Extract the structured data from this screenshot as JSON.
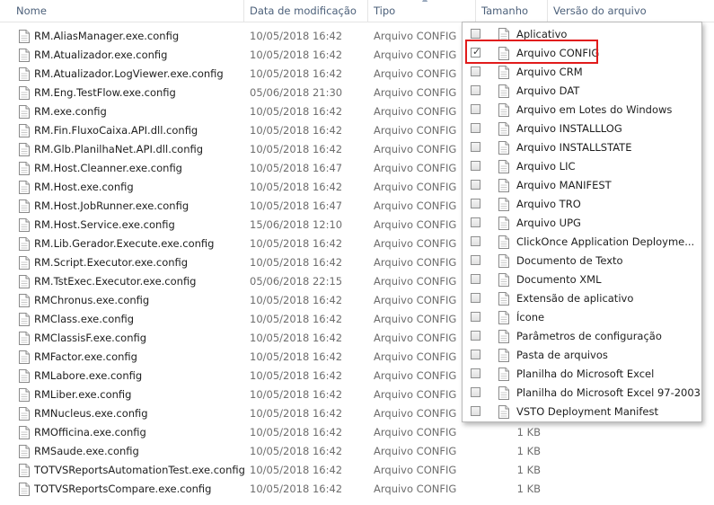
{
  "header": {
    "name": "Nome",
    "date": "Data de modificação",
    "type": "Tipo",
    "size": "Tamanho",
    "version": "Versão do arquivo"
  },
  "files": [
    {
      "name": "RM.AliasManager.exe.config",
      "date": "10/05/2018 16:42",
      "type": "Arquivo CONFIG",
      "size": ""
    },
    {
      "name": "RM.Atualizador.exe.config",
      "date": "10/05/2018 16:42",
      "type": "Arquivo CONFIG",
      "size": ""
    },
    {
      "name": "RM.Atualizador.LogViewer.exe.config",
      "date": "10/05/2018 16:42",
      "type": "Arquivo CONFIG",
      "size": ""
    },
    {
      "name": "RM.Eng.TestFlow.exe.config",
      "date": "05/06/2018 21:30",
      "type": "Arquivo CONFIG",
      "size": ""
    },
    {
      "name": "RM.exe.config",
      "date": "10/05/2018 16:42",
      "type": "Arquivo CONFIG",
      "size": ""
    },
    {
      "name": "RM.Fin.FluxoCaixa.API.dll.config",
      "date": "10/05/2018 16:42",
      "type": "Arquivo CONFIG",
      "size": ""
    },
    {
      "name": "RM.Glb.PlanilhaNet.API.dll.config",
      "date": "10/05/2018 16:42",
      "type": "Arquivo CONFIG",
      "size": ""
    },
    {
      "name": "RM.Host.Cleanner.exe.config",
      "date": "10/05/2018 16:47",
      "type": "Arquivo CONFIG",
      "size": ""
    },
    {
      "name": "RM.Host.exe.config",
      "date": "10/05/2018 16:42",
      "type": "Arquivo CONFIG",
      "size": ""
    },
    {
      "name": "RM.Host.JobRunner.exe.config",
      "date": "10/05/2018 16:47",
      "type": "Arquivo CONFIG",
      "size": ""
    },
    {
      "name": "RM.Host.Service.exe.config",
      "date": "15/06/2018 12:10",
      "type": "Arquivo CONFIG",
      "size": ""
    },
    {
      "name": "RM.Lib.Gerador.Execute.exe.config",
      "date": "10/05/2018 16:42",
      "type": "Arquivo CONFIG",
      "size": ""
    },
    {
      "name": "RM.Script.Executor.exe.config",
      "date": "10/05/2018 16:42",
      "type": "Arquivo CONFIG",
      "size": ""
    },
    {
      "name": "RM.TstExec.Executor.exe.config",
      "date": "05/06/2018 22:15",
      "type": "Arquivo CONFIG",
      "size": ""
    },
    {
      "name": "RMChronus.exe.config",
      "date": "10/05/2018 16:42",
      "type": "Arquivo CONFIG",
      "size": ""
    },
    {
      "name": "RMClass.exe.config",
      "date": "10/05/2018 16:42",
      "type": "Arquivo CONFIG",
      "size": ""
    },
    {
      "name": "RMClassisF.exe.config",
      "date": "10/05/2018 16:42",
      "type": "Arquivo CONFIG",
      "size": ""
    },
    {
      "name": "RMFactor.exe.config",
      "date": "10/05/2018 16:42",
      "type": "Arquivo CONFIG",
      "size": ""
    },
    {
      "name": "RMLabore.exe.config",
      "date": "10/05/2018 16:42",
      "type": "Arquivo CONFIG",
      "size": ""
    },
    {
      "name": "RMLiber.exe.config",
      "date": "10/05/2018 16:42",
      "type": "Arquivo CONFIG",
      "size": ""
    },
    {
      "name": "RMNucleus.exe.config",
      "date": "10/05/2018 16:42",
      "type": "Arquivo CONFIG",
      "size": ""
    },
    {
      "name": "RMOfficina.exe.config",
      "date": "10/05/2018 16:42",
      "type": "Arquivo CONFIG",
      "size": "1 KB"
    },
    {
      "name": "RMSaude.exe.config",
      "date": "10/05/2018 16:42",
      "type": "Arquivo CONFIG",
      "size": "1 KB"
    },
    {
      "name": "TOTVSReportsAutomationTest.exe.config",
      "date": "10/05/2018 16:42",
      "type": "Arquivo CONFIG",
      "size": "1 KB"
    },
    {
      "name": "TOTVSReportsCompare.exe.config",
      "date": "10/05/2018 16:42",
      "type": "Arquivo CONFIG",
      "size": "1 KB"
    }
  ],
  "filter": {
    "options": [
      {
        "label": "Aplicativo",
        "checked": false
      },
      {
        "label": "Arquivo CONFIG",
        "checked": true
      },
      {
        "label": "Arquivo CRM",
        "checked": false
      },
      {
        "label": "Arquivo DAT",
        "checked": false
      },
      {
        "label": "Arquivo em Lotes do Windows",
        "checked": false
      },
      {
        "label": "Arquivo INSTALLLOG",
        "checked": false
      },
      {
        "label": "Arquivo INSTALLSTATE",
        "checked": false
      },
      {
        "label": "Arquivo LIC",
        "checked": false
      },
      {
        "label": "Arquivo MANIFEST",
        "checked": false
      },
      {
        "label": "Arquivo TRO",
        "checked": false
      },
      {
        "label": "Arquivo UPG",
        "checked": false
      },
      {
        "label": "ClickOnce Application Deployme...",
        "checked": false
      },
      {
        "label": "Documento de Texto",
        "checked": false
      },
      {
        "label": "Documento XML",
        "checked": false
      },
      {
        "label": "Extensão de aplicativo",
        "checked": false
      },
      {
        "label": "Ícone",
        "checked": false
      },
      {
        "label": "Parâmetros de configuração",
        "checked": false
      },
      {
        "label": "Pasta de arquivos",
        "checked": false
      },
      {
        "label": "Planilha do Microsoft Excel",
        "checked": false
      },
      {
        "label": "Planilha do Microsoft Excel 97-2003",
        "checked": false
      },
      {
        "label": "VSTO Deployment Manifest",
        "checked": false
      }
    ]
  },
  "colors": {
    "header_text": "#4c607a",
    "highlight_border": "#e11b1b"
  }
}
